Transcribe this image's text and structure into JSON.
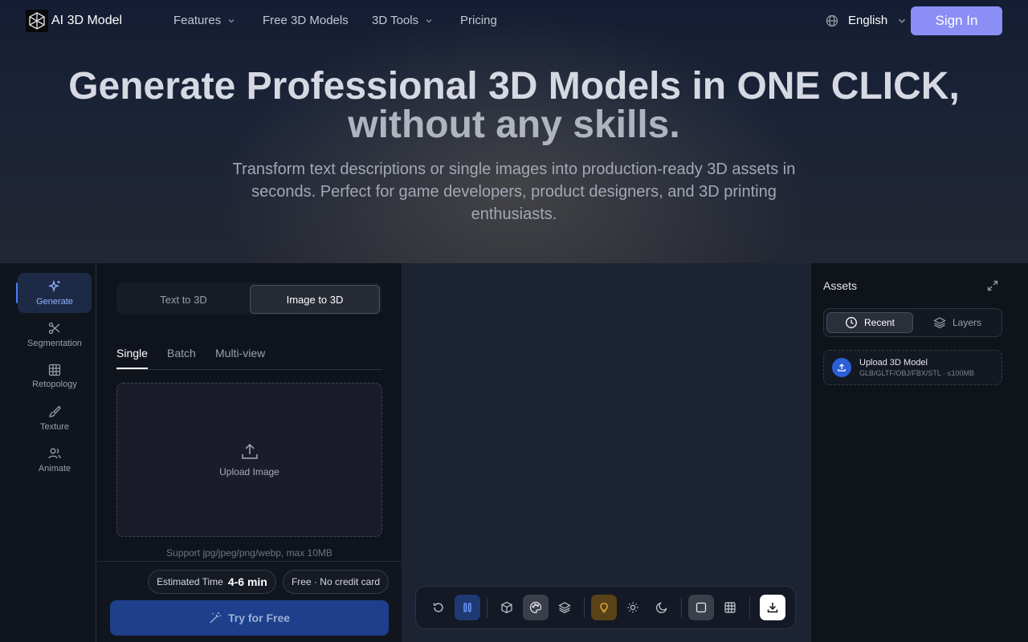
{
  "nav": {
    "brand": "AI 3D Model",
    "items": [
      {
        "label": "Features",
        "has_dropdown": true
      },
      {
        "label": "Free 3D Models",
        "has_dropdown": false
      },
      {
        "label": "3D Tools",
        "has_dropdown": true
      },
      {
        "label": "Pricing",
        "has_dropdown": false
      }
    ],
    "language": "English",
    "signin_label": "Sign In"
  },
  "hero": {
    "title_line1": "Generate Professional 3D Models in ONE CLICK,",
    "title_line2": "without any skills.",
    "subtitle": "Transform text descriptions or single images into production-ready 3D assets in seconds. Perfect for game developers, product designers, and 3D printing enthusiasts."
  },
  "sidebar": {
    "items": [
      {
        "label": "Generate",
        "icon": "sparkles-icon",
        "active": true
      },
      {
        "label": "Segmentation",
        "icon": "scissors-icon",
        "active": false
      },
      {
        "label": "Retopology",
        "icon": "grid-icon",
        "active": false
      },
      {
        "label": "Texture",
        "icon": "brush-icon",
        "active": false
      },
      {
        "label": "Animate",
        "icon": "users-icon",
        "active": false
      }
    ]
  },
  "panel": {
    "mode_tabs": [
      {
        "label": "Text to 3D",
        "active": false
      },
      {
        "label": "Image to 3D",
        "active": true
      }
    ],
    "sub_tabs": [
      {
        "label": "Single",
        "active": true
      },
      {
        "label": "Batch",
        "active": false
      },
      {
        "label": "Multi-view",
        "active": false
      }
    ],
    "upload_label": "Upload Image",
    "support_text": "Support jpg/jpeg/png/webp, max 10MB",
    "estimated_label": "Estimated Time",
    "estimated_value": "4-6 min",
    "free_label": "Free · No credit card",
    "try_label": "Try for Free"
  },
  "toolbar": {
    "tools": [
      "rotate-icon",
      "pause-icon",
      "cube-icon",
      "palette-icon",
      "layers-icon",
      "bulb-icon",
      "sun-icon",
      "moon-icon",
      "square-icon",
      "grid-icon",
      "download-icon"
    ]
  },
  "assets": {
    "title": "Assets",
    "tabs": [
      {
        "label": "Recent",
        "active": true
      },
      {
        "label": "Layers",
        "active": false
      }
    ],
    "upload_title": "Upload 3D Model",
    "upload_sub": "GLB/GLTF/OBJ/FBX/STL · ≤100MB"
  },
  "colors": {
    "accent": "#8b8ff5",
    "primary_button": "#1d3f8c",
    "active_blue": "#4b7bf5"
  }
}
